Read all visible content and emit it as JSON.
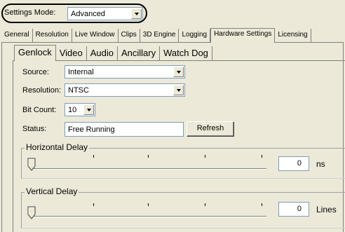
{
  "settings_mode": {
    "label": "Settings Mode:",
    "value": "Advanced"
  },
  "outer_tabs": [
    {
      "label": "General"
    },
    {
      "label": "Resolution"
    },
    {
      "label": "Live Window"
    },
    {
      "label": "Clips"
    },
    {
      "label": "3D Engine"
    },
    {
      "label": "Logging"
    },
    {
      "label": "Hardware Settings",
      "active": true
    },
    {
      "label": "Licensing"
    }
  ],
  "inner_tabs": [
    {
      "label": "Genlock",
      "active": true
    },
    {
      "label": "Video"
    },
    {
      "label": "Audio"
    },
    {
      "label": "Ancillary"
    },
    {
      "label": "Watch Dog"
    }
  ],
  "genlock": {
    "source": {
      "label": "Source:",
      "value": "Internal"
    },
    "resolution": {
      "label": "Resolution:",
      "value": "NTSC"
    },
    "bit_count": {
      "label": "Bit Count:",
      "value": "10"
    },
    "status": {
      "label": "Status:",
      "value": "Free Running"
    },
    "refresh_label": "Refresh",
    "horizontal_delay": {
      "title": "Horizontal Delay",
      "value": "0",
      "unit": "ns",
      "slider_position": 0
    },
    "vertical_delay": {
      "title": "Vertical Delay",
      "value": "0",
      "unit": "Lines",
      "slider_position": 0
    }
  }
}
